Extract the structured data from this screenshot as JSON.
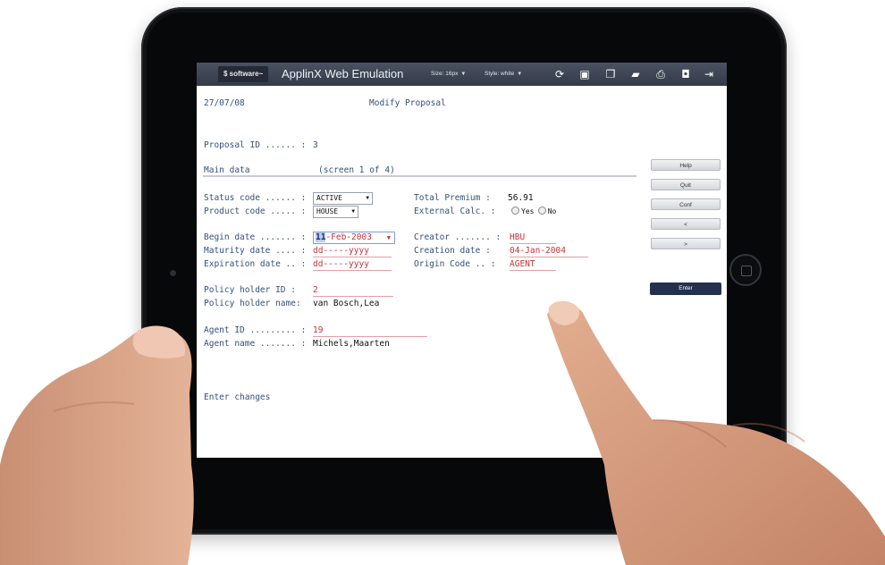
{
  "toolbar": {
    "logo_text": "$ software~",
    "app_title": "ApplinX Web Emulation",
    "size_label": "Size: 16px",
    "style_label": "Style: white",
    "icons": [
      "refresh-icon",
      "window-icon",
      "copy-icon",
      "folder-icon",
      "print-icon",
      "camera-icon",
      "exit-icon"
    ]
  },
  "screen": {
    "date": "27/07/08",
    "title": "Modify Proposal",
    "proposal_id_label": "Proposal ID ...... :",
    "proposal_id_value": "3",
    "section_label": "Main data",
    "section_screen": "(screen 1 of 4)",
    "status_code_label": "Status code ...... :",
    "status_code_value": "ACTIVE",
    "product_code_label": "Product code ..... :",
    "product_code_value": "HOUSE",
    "total_premium_label": "Total Premium  :",
    "total_premium_value": "56.91",
    "external_calc_label": "External Calc. :",
    "external_calc_yes": "Yes",
    "external_calc_no": "No",
    "begin_date_label": "Begin date ....... :",
    "begin_date_day": "11",
    "begin_date_rest": "-Feb-2003",
    "maturity_date_label": "Maturity date .... :",
    "maturity_date_value": "dd-----yyyy",
    "expiration_date_label": "Expiration date .. :",
    "expiration_date_value": "dd-----yyyy",
    "creator_label": "Creator ....... :",
    "creator_value": "HBU",
    "creation_date_label": "Creation date   :",
    "creation_date_value": "04-Jan-2004",
    "origin_code_label": "Origin Code .. :",
    "origin_code_value": "AGENT",
    "policy_holder_id_label": "Policy holder ID   :",
    "policy_holder_id_value": "2",
    "policy_holder_name_label": "Policy holder name:",
    "policy_holder_name_value": "van Bosch,Lea",
    "agent_id_label": "Agent ID ......... :",
    "agent_id_value": "19",
    "agent_name_label": "Agent name ....... :",
    "agent_name_value": "Michels,Maarten",
    "status_message": "Enter changes"
  },
  "side_buttons": {
    "help": "Help",
    "quit": "Quit",
    "conf": "Conf",
    "prev": "<",
    "next": ">",
    "enter": "Enter"
  },
  "colors": {
    "tablet_bezel": "#111214",
    "toolbar_bg": "#3d4453",
    "label_text": "#36507a",
    "input_text": "#c8323a",
    "enter_button": "#23304e"
  }
}
